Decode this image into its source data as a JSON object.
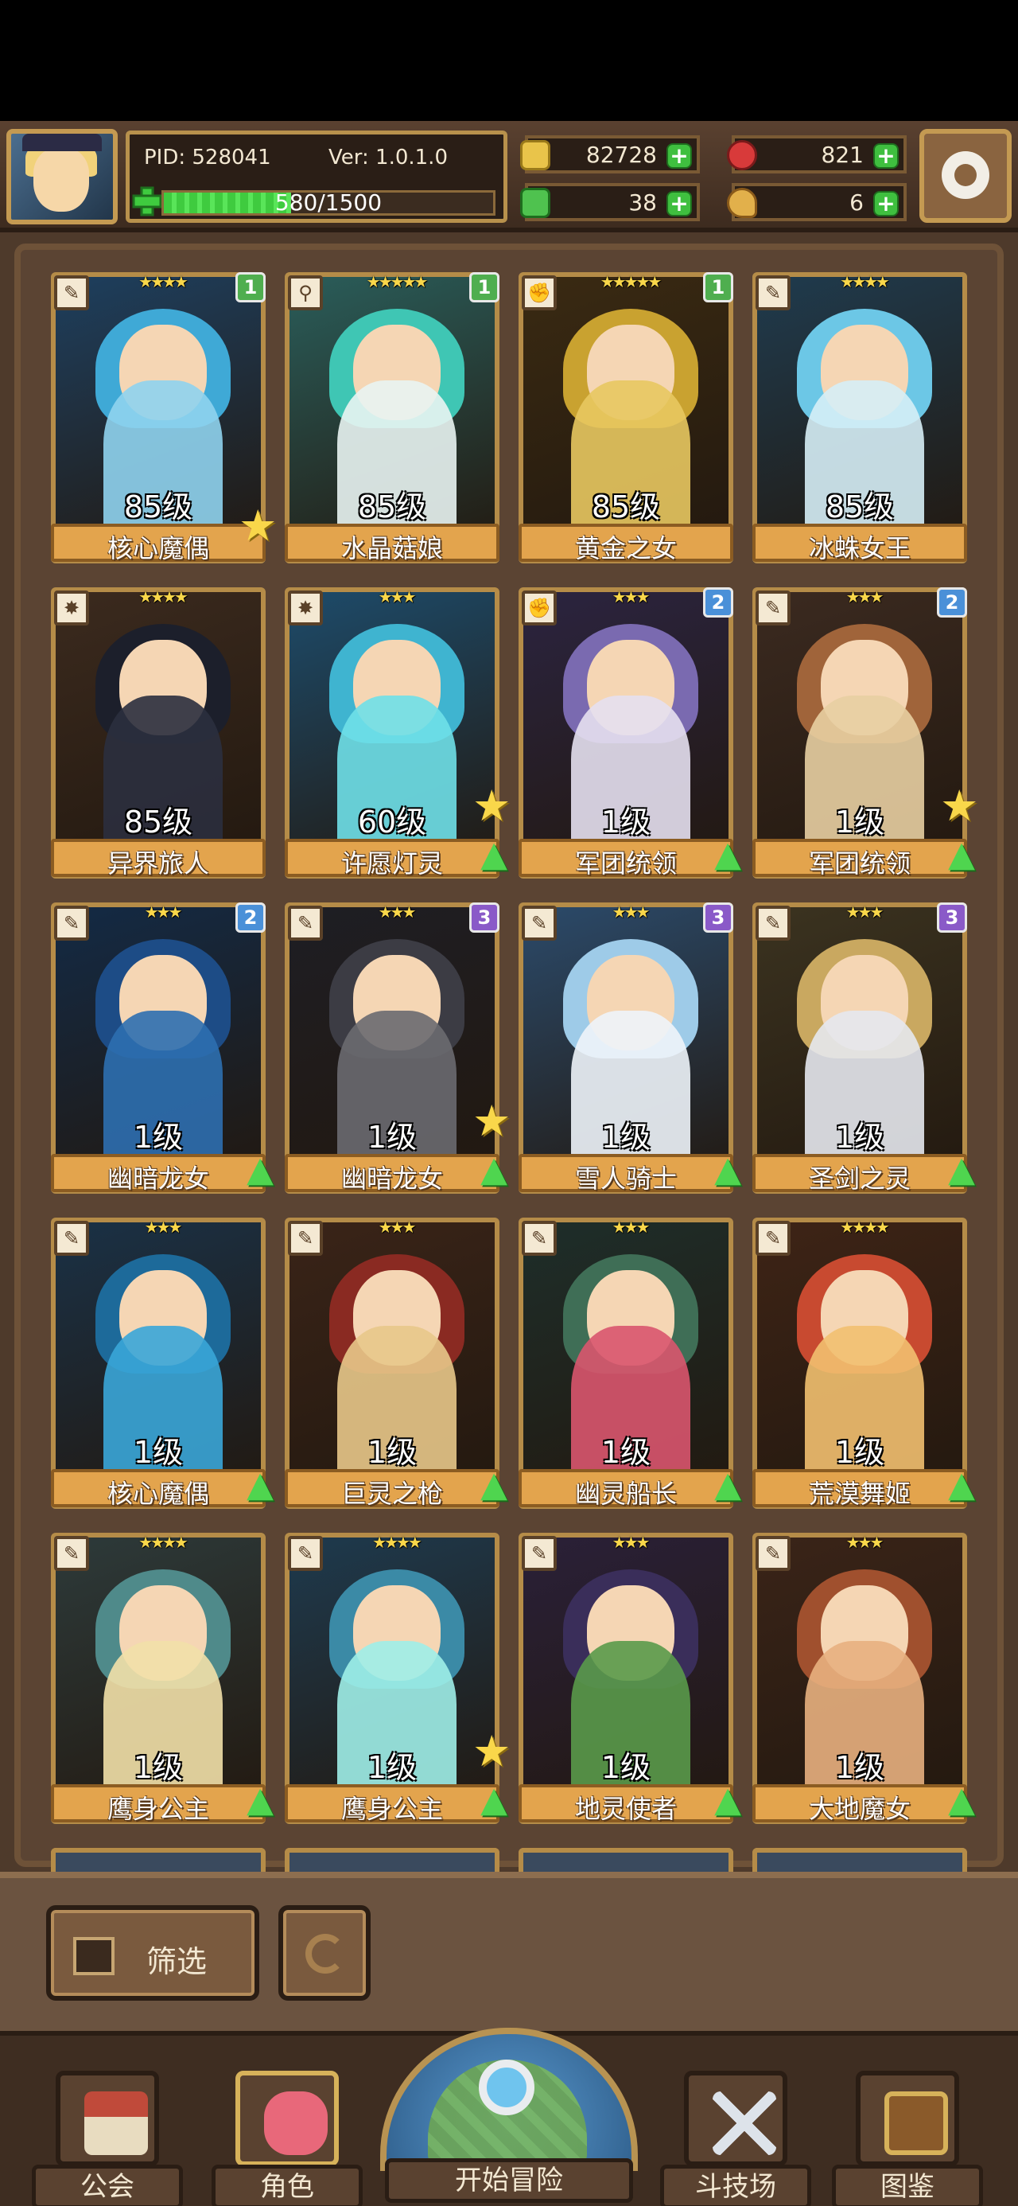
{
  "header": {
    "pid": "PID: 528041",
    "version": "Ver: 1.0.1.0",
    "xp": "580/1500",
    "xp_progress": 0.387,
    "resources": [
      {
        "name": "gold",
        "value": "82728",
        "color": "#e9c44a"
      },
      {
        "name": "ruby",
        "value": "821",
        "color": "#d83a3a"
      },
      {
        "name": "clover",
        "value": "38",
        "color": "#4fc24f"
      },
      {
        "name": "drumstick",
        "value": "6",
        "color": "#e2b04b"
      }
    ]
  },
  "heroes": [
    {
      "name": "核心魔偶",
      "level": "85级",
      "stars": "★★★★",
      "tier": "1",
      "tier_color": "#4fae4f",
      "role": "✎",
      "star_badge": true,
      "upgrade": false,
      "palette": [
        "#1e3f5e",
        "#8fd3ee",
        "#3fa9d6"
      ]
    },
    {
      "name": "水晶菇娘",
      "level": "85级",
      "stars": "★★★★★",
      "tier": "1",
      "tier_color": "#4fae4f",
      "role": "⚲",
      "star_badge": false,
      "upgrade": false,
      "palette": [
        "#2a5d5a",
        "#e9f4f2",
        "#3fc6b4"
      ]
    },
    {
      "name": "黄金之女",
      "level": "85级",
      "stars": "★★★★★",
      "tier": "1",
      "tier_color": "#4fae4f",
      "role": "✊",
      "star_badge": false,
      "upgrade": false,
      "palette": [
        "#3a2a12",
        "#e8c860",
        "#c9a230"
      ]
    },
    {
      "name": "冰蛛女王",
      "level": "85级",
      "stars": "★★★★",
      "tier": "",
      "tier_color": "",
      "role": "✎",
      "star_badge": false,
      "upgrade": false,
      "palette": [
        "#1f3b4e",
        "#d6eef6",
        "#6cc7e6"
      ]
    },
    {
      "name": "异界旅人",
      "level": "85级",
      "stars": "★★★★",
      "tier": "",
      "tier_color": "",
      "role": "✸",
      "star_badge": false,
      "upgrade": false,
      "palette": [
        "#3b2a1e",
        "#2b2f3e",
        "#1c1f2b"
      ]
    },
    {
      "name": "许愿灯灵",
      "level": "60级",
      "stars": "★★★",
      "tier": "",
      "tier_color": "",
      "role": "✸",
      "star_badge": true,
      "upgrade": true,
      "palette": [
        "#1d4b6a",
        "#6fe0e8",
        "#3fb4d0"
      ]
    },
    {
      "name": "军团统领",
      "level": "1级",
      "stars": "★★★",
      "tier": "2",
      "tier_color": "#4a90d8",
      "role": "✊",
      "star_badge": false,
      "upgrade": true,
      "palette": [
        "#2b2440",
        "#e6e0ef",
        "#7a6ab0"
      ]
    },
    {
      "name": "军团统领",
      "level": "1级",
      "stars": "★★★",
      "tier": "2",
      "tier_color": "#4a90d8",
      "role": "✎",
      "star_badge": true,
      "upgrade": true,
      "palette": [
        "#3b2a20",
        "#e8cfa2",
        "#a0643a"
      ]
    },
    {
      "name": "幽暗龙女",
      "level": "1级",
      "stars": "★★★",
      "tier": "2",
      "tier_color": "#4a90d8",
      "role": "✎",
      "star_badge": false,
      "upgrade": true,
      "palette": [
        "#132a45",
        "#2d6fb0",
        "#1d4c86"
      ]
    },
    {
      "name": "幽暗龙女",
      "level": "1级",
      "stars": "★★★",
      "tier": "3",
      "tier_color": "#8a5ac8",
      "role": "✎",
      "star_badge": true,
      "upgrade": true,
      "palette": [
        "#1e1e24",
        "#6a6a70",
        "#3c3c44"
      ]
    },
    {
      "name": "雪人骑士",
      "level": "1级",
      "stars": "★★★",
      "tier": "3",
      "tier_color": "#8a5ac8",
      "role": "✎",
      "star_badge": false,
      "upgrade": true,
      "palette": [
        "#2b4a6a",
        "#eef4fa",
        "#9ecbe8"
      ]
    },
    {
      "name": "圣剑之灵",
      "level": "1级",
      "stars": "★★★",
      "tier": "3",
      "tier_color": "#8a5ac8",
      "role": "✎",
      "star_badge": false,
      "upgrade": true,
      "palette": [
        "#3b3320",
        "#e6e8ee",
        "#c9a860"
      ]
    },
    {
      "name": "核心魔偶",
      "level": "1级",
      "stars": "★★★",
      "tier": "",
      "tier_color": "",
      "role": "✎",
      "star_badge": false,
      "upgrade": true,
      "palette": [
        "#1a3146",
        "#3aa6d8",
        "#1d6a9a"
      ]
    },
    {
      "name": "巨灵之枪",
      "level": "1级",
      "stars": "★★★",
      "tier": "",
      "tier_color": "",
      "role": "✎",
      "star_badge": false,
      "upgrade": true,
      "palette": [
        "#3a2418",
        "#e8c88a",
        "#8a2a22"
      ]
    },
    {
      "name": "幽灵船长",
      "level": "1级",
      "stars": "★★★",
      "tier": "",
      "tier_color": "",
      "role": "✎",
      "star_badge": false,
      "upgrade": true,
      "palette": [
        "#1e2e2a",
        "#d9556e",
        "#3f6e56"
      ]
    },
    {
      "name": "荒漠舞姬",
      "level": "1级",
      "stars": "★★★★",
      "tier": "",
      "tier_color": "",
      "role": "✎",
      "star_badge": false,
      "upgrade": true,
      "palette": [
        "#3e2416",
        "#f2c070",
        "#c84a30"
      ]
    },
    {
      "name": "鹰身公主",
      "level": "1级",
      "stars": "★★★★",
      "tier": "",
      "tier_color": "",
      "role": "✎",
      "star_badge": false,
      "upgrade": true,
      "palette": [
        "#2d3a3a",
        "#f2e0a8",
        "#4f8a8a"
      ]
    },
    {
      "name": "鹰身公主",
      "level": "1级",
      "stars": "★★★★",
      "tier": "",
      "tier_color": "",
      "role": "✎",
      "star_badge": true,
      "upgrade": true,
      "palette": [
        "#1e3a4e",
        "#9eeee8",
        "#3b8aa6"
      ]
    },
    {
      "name": "地灵使者",
      "level": "1级",
      "stars": "★★★",
      "tier": "",
      "tier_color": "",
      "role": "✎",
      "star_badge": false,
      "upgrade": true,
      "palette": [
        "#2a2038",
        "#5a9a4a",
        "#3a2e5a"
      ]
    },
    {
      "name": "大地魔女",
      "level": "1级",
      "stars": "★★★",
      "tier": "",
      "tier_color": "",
      "role": "✎",
      "star_badge": false,
      "upgrade": true,
      "palette": [
        "#3a2418",
        "#e8b080",
        "#a0502e"
      ]
    }
  ],
  "filter": {
    "label": "筛选"
  },
  "nav": {
    "guild": "公会",
    "roles": "角色",
    "adventure": "开始冒险",
    "arena": "斗技场",
    "codex": "图鉴"
  }
}
